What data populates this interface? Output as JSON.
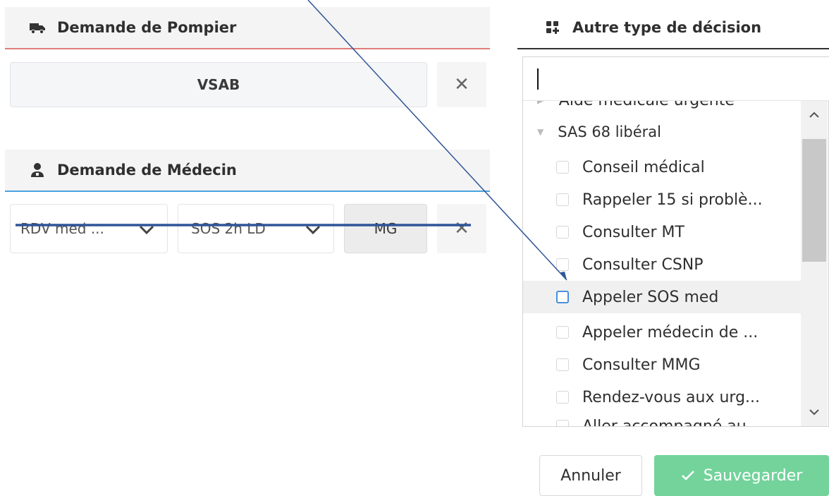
{
  "pompier": {
    "title": "Demande de Pompier",
    "value": "VSAB",
    "clear_glyph": "✕",
    "icon": "truck-icon",
    "accent": "#e07c7c"
  },
  "medecin": {
    "title": "Demande de Médecin",
    "icon": "doctor-icon",
    "accent": "#4aa3df",
    "select1": "RDV med ...",
    "select2": "SOS 2h LD",
    "button": "MG",
    "clear_glyph": "✕"
  },
  "decision": {
    "title": "Autre type de décision",
    "icon": "grid-icon",
    "search_value": "",
    "groups": [
      {
        "label": "Aide médicale urgente"
      },
      {
        "label": "SAS 68 libéral"
      }
    ],
    "items": [
      {
        "label": "Conseil médical"
      },
      {
        "label": "Rappeler 15 si problè..."
      },
      {
        "label": "Consulter MT"
      },
      {
        "label": "Consulter CSNP"
      },
      {
        "label": "Appeler SOS med"
      },
      {
        "label": "Appeler médecin de ..."
      },
      {
        "label": "Consulter MMG"
      },
      {
        "label": "Rendez-vous aux urg..."
      },
      {
        "label": "Aller accompagné au"
      }
    ]
  },
  "actions": {
    "cancel": "Annuler",
    "save": "Sauvegarder",
    "save_color": "#6fcf97"
  }
}
